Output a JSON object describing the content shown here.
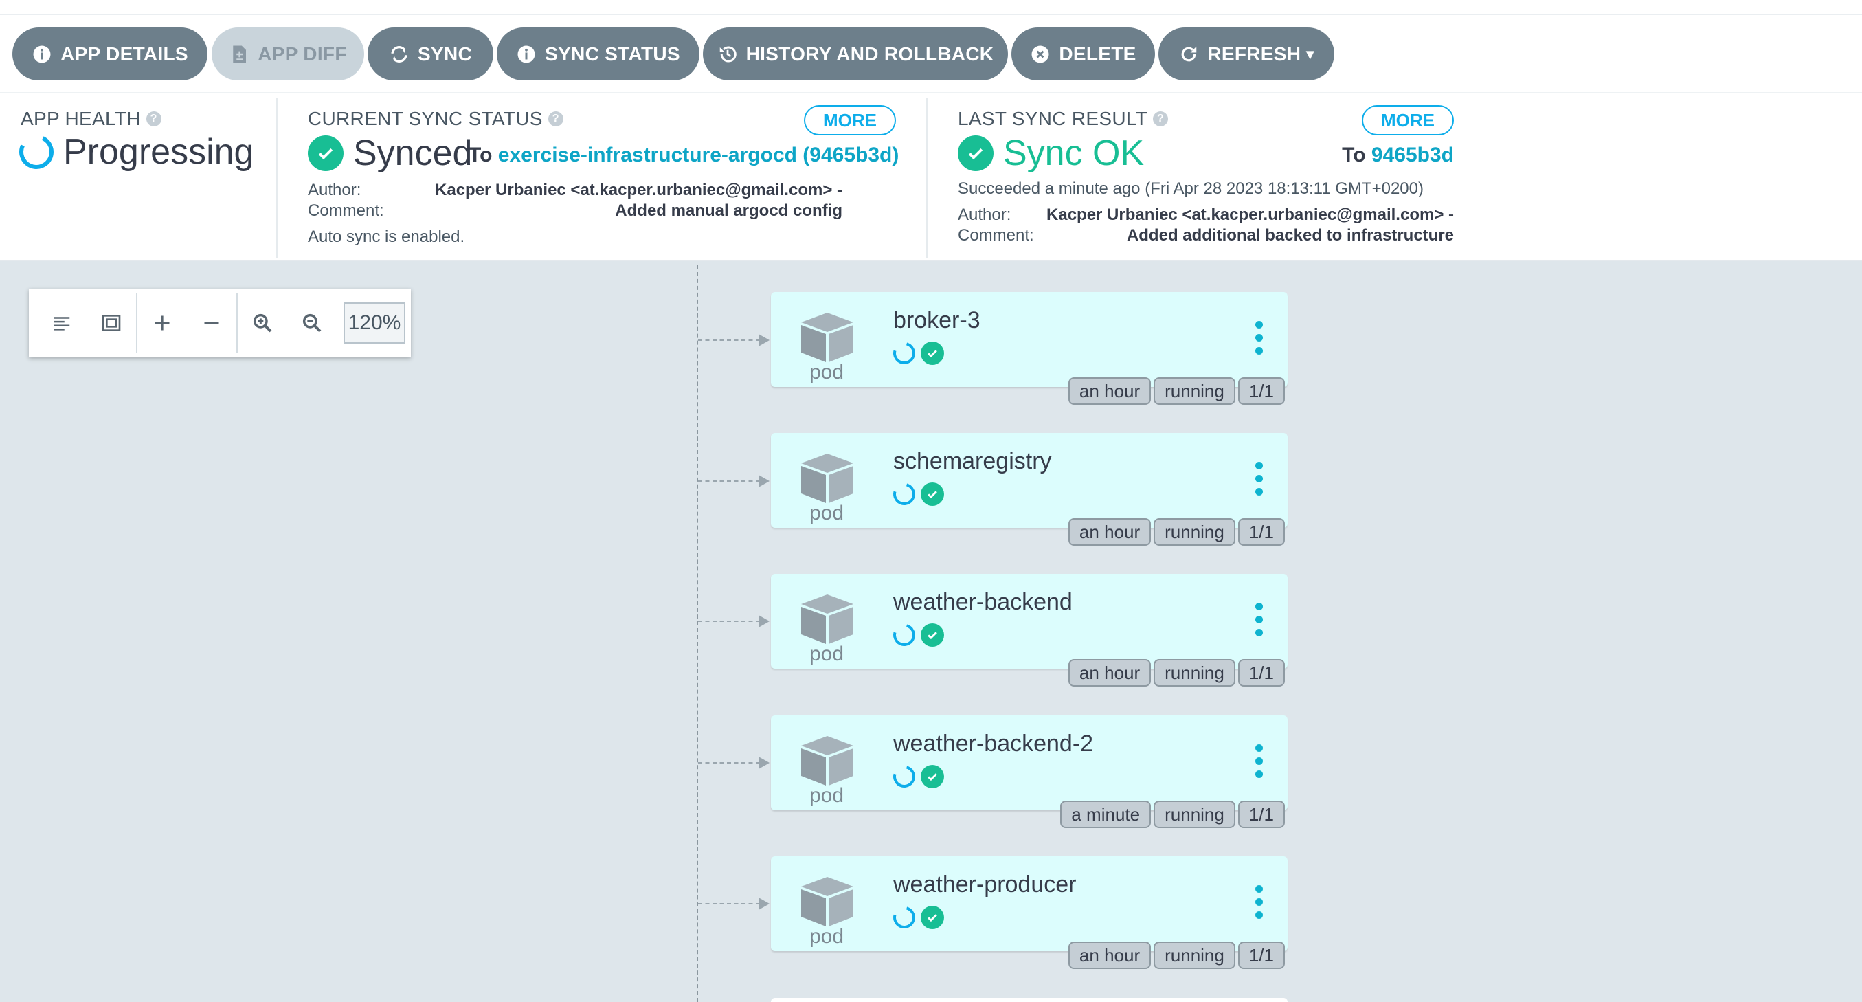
{
  "toolbar": {
    "buttons": [
      {
        "label": "APP DETAILS",
        "icon": "info-icon"
      },
      {
        "label": "APP DIFF",
        "icon": "file-diff-icon",
        "disabled": true
      },
      {
        "label": "SYNC",
        "icon": "sync-icon"
      },
      {
        "label": "SYNC STATUS",
        "icon": "info-icon"
      },
      {
        "label": "HISTORY AND ROLLBACK",
        "icon": "history-icon"
      },
      {
        "label": "DELETE",
        "icon": "close-circle-icon"
      },
      {
        "label": "REFRESH",
        "icon": "refresh-icon",
        "caret": "▾"
      }
    ]
  },
  "app_health": {
    "label": "APP HEALTH",
    "value": "Progressing"
  },
  "current_sync": {
    "label": "CURRENT SYNC STATUS",
    "more": "MORE",
    "status": "Synced",
    "to_prefix": "To",
    "target": "exercise-infrastructure-argocd (9465b3d)",
    "author_label": "Author:",
    "author_value": "Kacper Urbaniec <at.kacper.urbaniec@gmail.com> -",
    "comment_label": "Comment:",
    "comment_value": "Added manual argocd config",
    "auto_sync": "Auto sync is enabled."
  },
  "last_sync": {
    "label": "LAST SYNC RESULT",
    "more": "MORE",
    "status": "Sync OK",
    "to_prefix": "To",
    "revision": "9465b3d",
    "succeeded": "Succeeded a minute ago (Fri Apr 28 2023 18:13:11 GMT+0200)",
    "author_label": "Author:",
    "author_value": "Kacper Urbaniec <at.kacper.urbaniec@gmail.com> -",
    "comment_label": "Comment:",
    "comment_value": "Added additional backed to infrastructure"
  },
  "zoom": {
    "value": "120%"
  },
  "nodes": [
    {
      "name": "broker-3",
      "kind": "pod",
      "age": "an hour",
      "state": "running",
      "ready": "1/1"
    },
    {
      "name": "schemaregistry",
      "kind": "pod",
      "age": "an hour",
      "state": "running",
      "ready": "1/1"
    },
    {
      "name": "weather-backend",
      "kind": "pod",
      "age": "an hour",
      "state": "running",
      "ready": "1/1"
    },
    {
      "name": "weather-backend-2",
      "kind": "pod",
      "age": "a minute",
      "state": "running",
      "ready": "1/1"
    },
    {
      "name": "weather-producer",
      "kind": "pod",
      "age": "an hour",
      "state": "running",
      "ready": "1/1"
    }
  ],
  "colors": {
    "button": "#6d7f8b",
    "accent": "#0dadea",
    "ok": "#18be94",
    "node_bg": "#dcfdfd",
    "canvas_bg": "#dee6eb"
  }
}
